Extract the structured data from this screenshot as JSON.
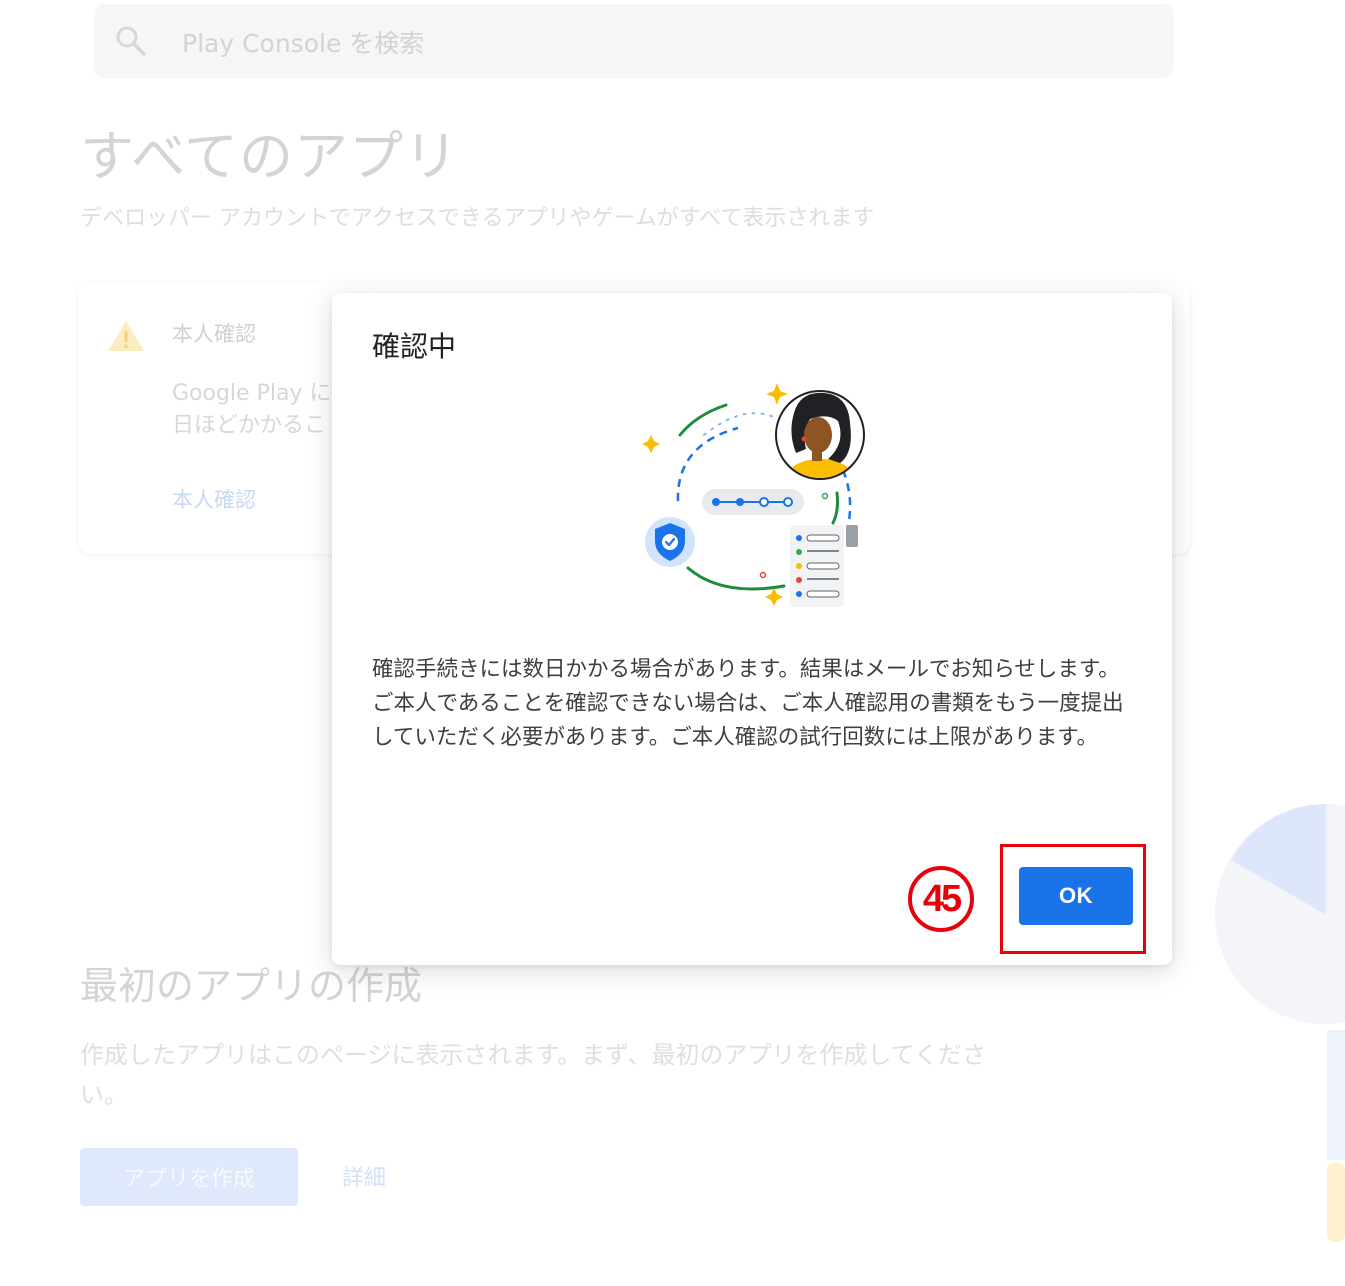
{
  "background": {
    "search": {
      "placeholder": "Play Console を検索",
      "icon": "search-icon"
    },
    "page_title": "すべてのアプリ",
    "page_subtitle": "デベロッパー アカウントでアクセスできるアプリやゲームがすべて表示されます",
    "verification_card": {
      "icon": "warning-icon",
      "title": "本人確認",
      "text_line1": "Google Play に",
      "text_line2": "日ほどかかるこ",
      "link": "本人確認"
    },
    "first_app": {
      "title": "最初のアプリの作成",
      "description": "作成したアプリはこのページに表示されます。まず、最初のアプリを作成してください。",
      "create_button": "アプリを作成",
      "details_link": "詳細"
    }
  },
  "dialog": {
    "title": "確認中",
    "body": "確認手続きには数日かかる場合があります。結果はメールでお知らせします。ご本人であることを確認できない場合は、ご本人確認用の書類をもう一度提出していただく必要があります。ご本人確認の試行回数には上限があります。",
    "ok_label": "OK"
  },
  "annotation": {
    "step_number": "45",
    "color": "#e8000b"
  },
  "colors": {
    "primary": "#1a73e8",
    "annotation": "#e8000b"
  }
}
